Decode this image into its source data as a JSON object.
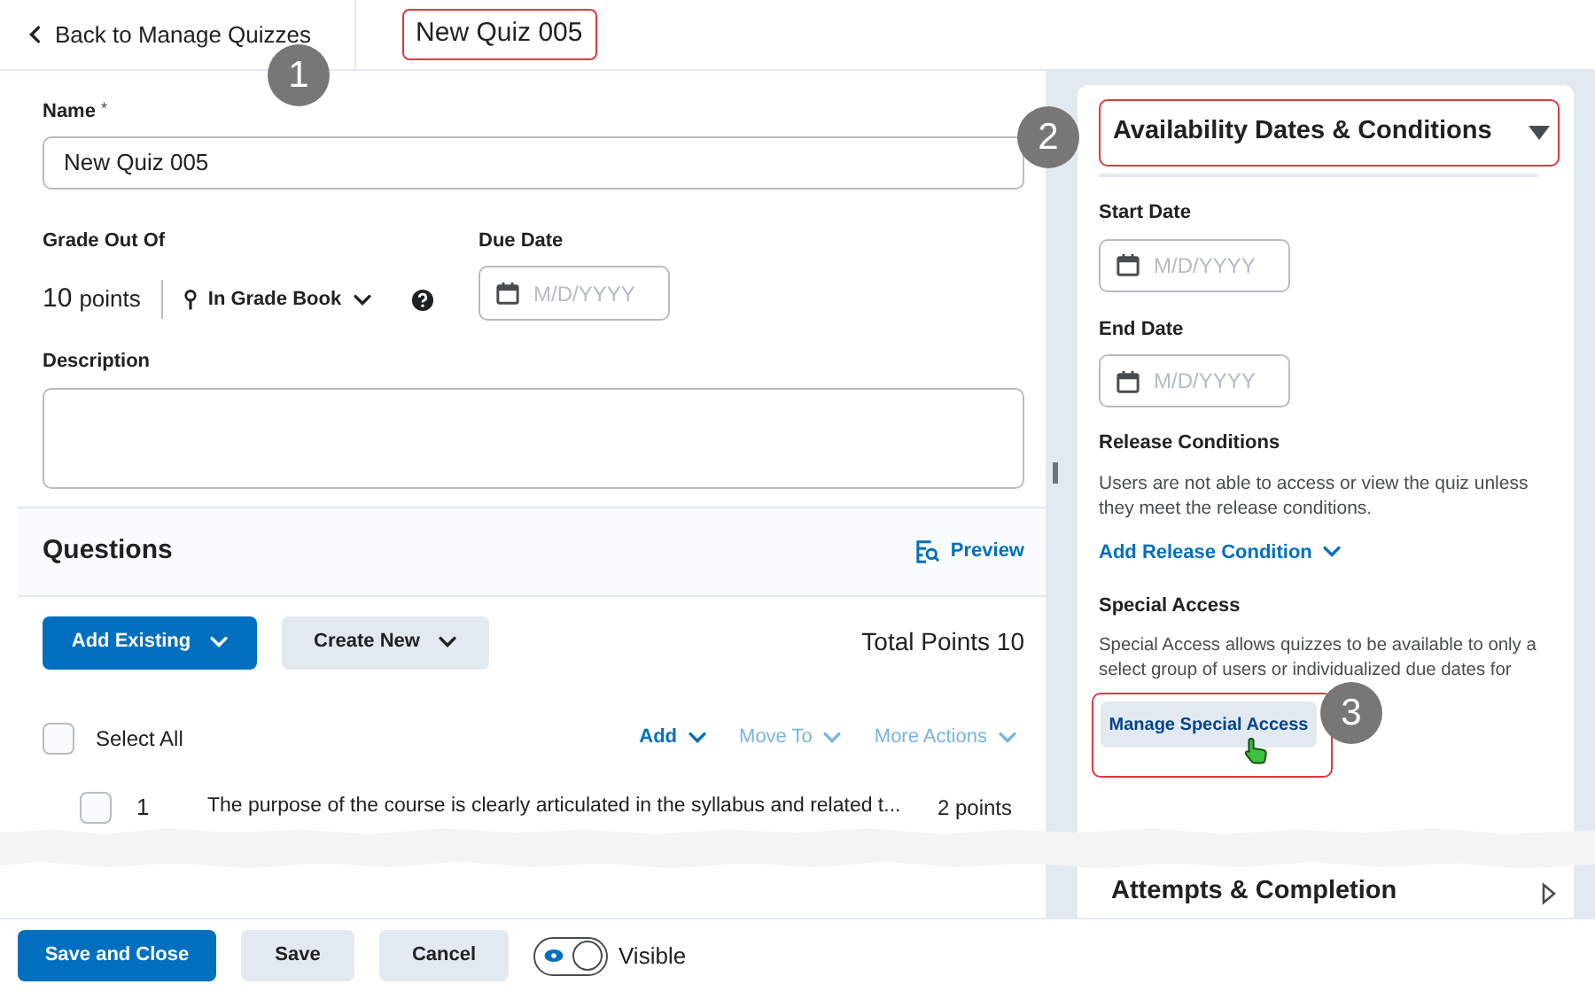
{
  "header": {
    "back_link": "Back to Manage Quizzes",
    "title": "New Quiz 005",
    "title_highlighted": true
  },
  "form": {
    "name": {
      "label": "Name",
      "required_mark": "*",
      "value": "New Quiz 005"
    },
    "grade": {
      "label": "Grade Out Of",
      "points": "10",
      "points_unit": "points",
      "grade_book": "In Grade Book"
    },
    "due_date": {
      "label": "Due Date",
      "placeholder": "M/D/YYYY"
    },
    "description": {
      "label": "Description"
    }
  },
  "questions": {
    "title": "Questions",
    "preview": "Preview",
    "add_existing": "Add Existing",
    "create_new": "Create New",
    "total_points": "Total Points 10",
    "select_all": {
      "label": "Select All",
      "checked": false
    },
    "actions": [
      {
        "label": "Add",
        "disabled": false
      },
      {
        "label": "Move To",
        "disabled": true
      },
      {
        "label": "More Actions",
        "disabled": true
      }
    ],
    "rows": [
      {
        "number": "1",
        "text": "The purpose of the course is clearly articulated in the syllabus and related t...",
        "points": "2 points",
        "checked": false
      }
    ]
  },
  "availability": {
    "title": "Availability Dates & Conditions",
    "expanded": true,
    "highlighted": true,
    "start_date": {
      "label": "Start Date",
      "placeholder": "M/D/YYYY"
    },
    "end_date": {
      "label": "End Date",
      "placeholder": "M/D/YYYY"
    },
    "release_conditions": {
      "label": "Release Conditions",
      "text": "Users are not able to access or view the quiz unless they meet the release conditions.",
      "link": "Add Release Condition"
    },
    "special_access": {
      "label": "Special Access",
      "text": "Special Access allows quizzes to be available to only a select group of users or individualized due dates for",
      "button": "Manage Special Access",
      "highlighted": true
    }
  },
  "attempts": {
    "title": "Attempts & Completion",
    "expanded": false
  },
  "footer": {
    "buttons": [
      {
        "label": "Save and Close",
        "kind": "primary"
      },
      {
        "label": "Save",
        "kind": "secondary"
      },
      {
        "label": "Cancel",
        "kind": "secondary"
      }
    ],
    "visibility": {
      "label": "Visible",
      "on": true
    }
  },
  "callouts": [
    "1",
    "2",
    "3"
  ]
}
